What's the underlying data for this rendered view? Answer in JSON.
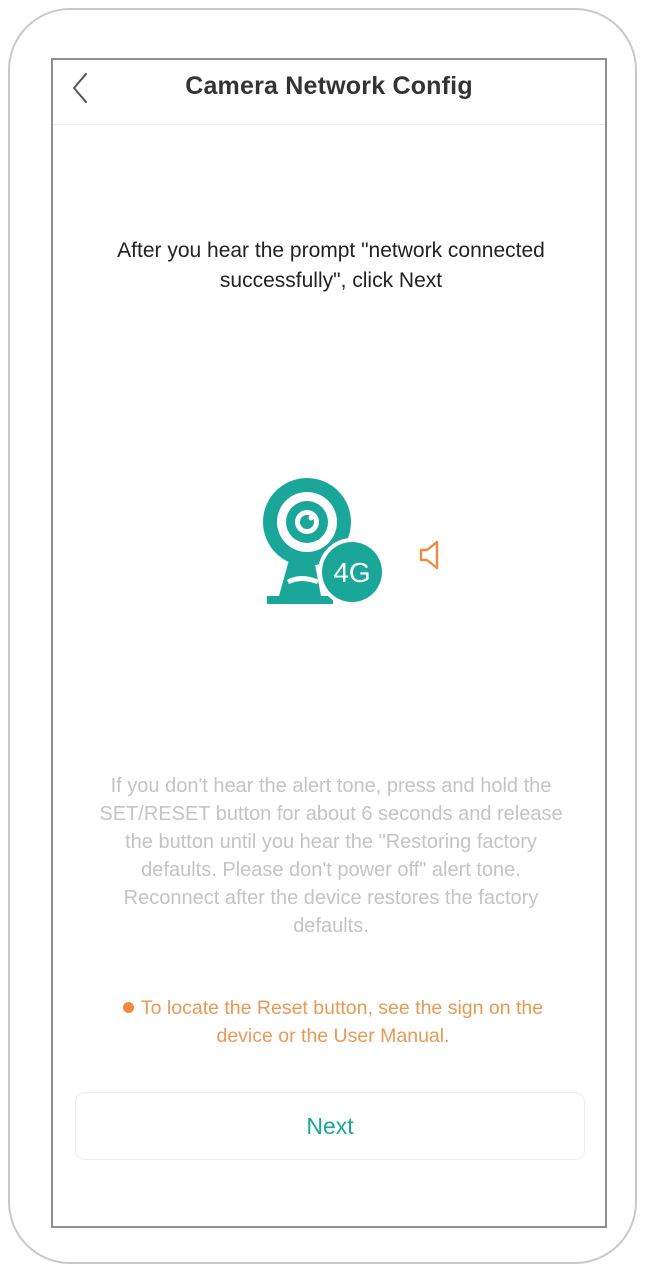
{
  "header": {
    "title": "Camera Network Config",
    "back_icon": "chevron-left-icon"
  },
  "main": {
    "instruction": "After you hear the prompt \"network connected successfully\", click Next",
    "illustration": {
      "icon": "camera-4g-icon",
      "badge_text": "4G",
      "speaker_icon": "speaker-icon"
    },
    "help_text": "If you don't hear the alert tone, press and hold the SET/RESET button for about 6 seconds and release the button until you hear the \"Restoring factory defaults. Please don't power off\" alert tone. Reconnect after the device restores the factory defaults.",
    "tip_text": "To locate the Reset button, see the sign on the device or the User Manual."
  },
  "footer": {
    "next_label": "Next"
  },
  "colors": {
    "accent_teal": "#1aa79a",
    "tip_orange": "#e89a55",
    "speaker_orange": "#ef8a3e",
    "muted_text": "#c4c4c4"
  }
}
